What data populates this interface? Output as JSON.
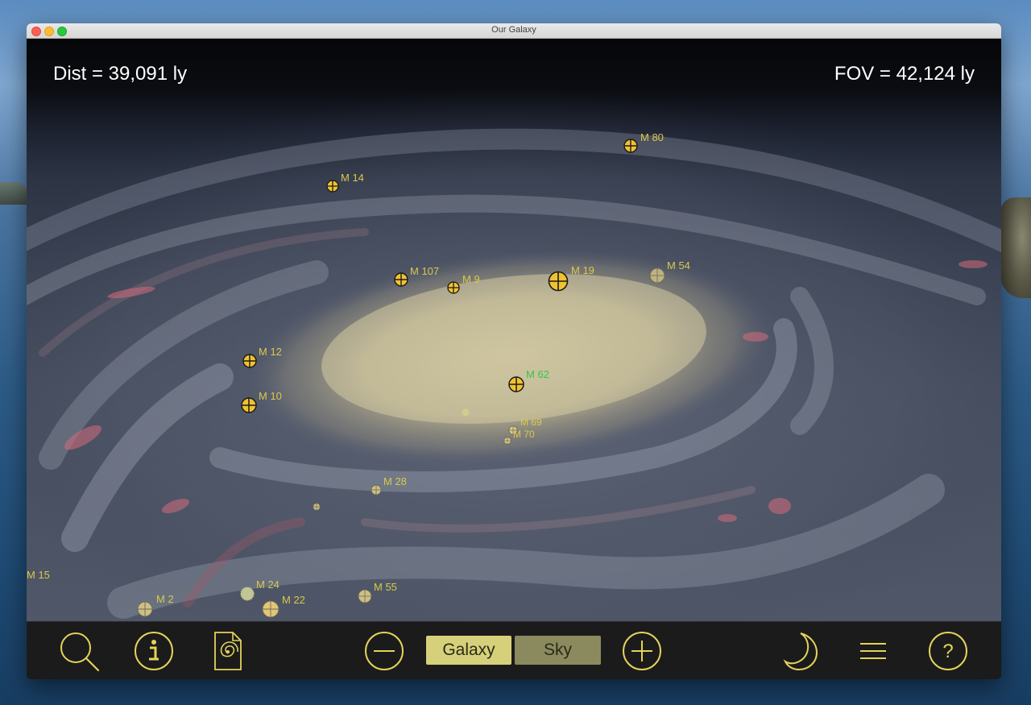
{
  "window": {
    "title": "Our Galaxy"
  },
  "readouts": {
    "distance": "Dist = 39,091 ly",
    "fov": "FOV = 42,124 ly"
  },
  "markers": [
    {
      "id": "m80",
      "label": "M 80",
      "kind": "crosshair"
    },
    {
      "id": "m14",
      "label": "M 14",
      "kind": "crosshair"
    },
    {
      "id": "m107",
      "label": "M 107",
      "kind": "crosshair"
    },
    {
      "id": "m9",
      "label": "M 9",
      "kind": "crosshair"
    },
    {
      "id": "m19",
      "label": "M 19",
      "kind": "crosshair"
    },
    {
      "id": "m54",
      "label": "M 54",
      "kind": "faint"
    },
    {
      "id": "m12",
      "label": "M 12",
      "kind": "crosshair"
    },
    {
      "id": "m62",
      "label": "M 62",
      "kind": "crosshair",
      "label_color": "#35c94a"
    },
    {
      "id": "m10",
      "label": "M 10",
      "kind": "crosshair"
    },
    {
      "id": "m69",
      "label": "M 69",
      "kind": "faint"
    },
    {
      "id": "m70",
      "label": "M 70",
      "kind": "faint"
    },
    {
      "id": "m28",
      "label": "M 28",
      "kind": "faint"
    },
    {
      "id": "m15",
      "label": "M 15",
      "kind": "label-only"
    },
    {
      "id": "m24",
      "label": "M 24",
      "kind": "starburst"
    },
    {
      "id": "m2",
      "label": "M 2",
      "kind": "faint"
    },
    {
      "id": "m22",
      "label": "M 22",
      "kind": "faint"
    },
    {
      "id": "m55",
      "label": "M 55",
      "kind": "faint"
    }
  ],
  "toolbar": {
    "search_icon": "search-icon",
    "info_icon": "info-icon",
    "document_icon": "galaxy-document-icon",
    "zoom_out_icon": "zoom-out-icon",
    "galaxy_label": "Galaxy",
    "sky_label": "Sky",
    "zoom_in_icon": "zoom-in-icon",
    "night_mode_icon": "moon-icon",
    "menu_icon": "menu-icon",
    "help_icon": "help-icon",
    "selected_mode": "Galaxy"
  },
  "colors": {
    "accent": "#d9c94a",
    "marker_fill": "#f0c230",
    "segment_selected": "#d6d07a",
    "segment_unselected": "#8b8a5e",
    "toolbar_bg": "#1b1b1b"
  }
}
